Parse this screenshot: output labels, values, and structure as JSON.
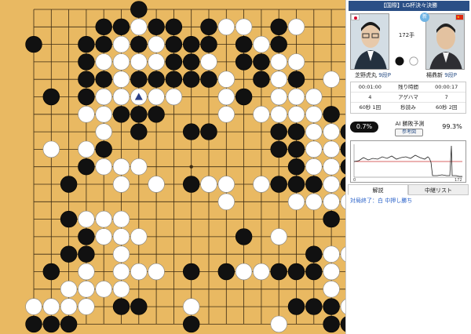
{
  "header": {
    "title": "【国際】LG杯決々決勝"
  },
  "players": {
    "black": {
      "name": "芝野虎丸",
      "rank": "9段P",
      "flag": "japan-flag-icon"
    },
    "white": {
      "name": "楊鼎新",
      "rank": "9段P",
      "flag": "china-flag-icon"
    }
  },
  "move_count": "172手",
  "info": {
    "time_left": {
      "black": "00:01:00",
      "label": "残り時間",
      "white": "00:00:17"
    },
    "captures": {
      "black": "4",
      "label": "アゲハマ",
      "white": "7"
    },
    "byoyomi": {
      "black": "60秒 1回",
      "label": "秒読み",
      "white": "60秒 2回"
    }
  },
  "ai": {
    "label": "AI 勝敗予測",
    "ref_button": "参考図",
    "black_pct": "0.7%",
    "white_pct": "99.3%"
  },
  "graph": {
    "x_start": "0",
    "x_end": "172"
  },
  "tabs": [
    {
      "label": "解説"
    },
    {
      "label": "中継リスト"
    }
  ],
  "comment": "対局終了：白 中押し勝ち",
  "board": {
    "size": 19,
    "last_move_marker": "triangle-marker",
    "rows": [
      "......B............",
      "....BBWBB.BWW.BW...",
      "B..BBWBWBBB.BWB....",
      "...BWWWWBBW.BBWW...",
      "...BBWBBBBBW.BWB.W.",
      ".B.BWWWWW..WB.WWW..",
      "...WWBBB...W.WWWWB.",
      "....W.B..BB...BBWWB",
      ".W.WB.........BBWWB",
      "...BWWW........BWWB",
      "..B..W.W.BWW.WBBBWB",
      "...........W...WWWW",
      "..BWWW...........B.",
      "...BWWW.....B.W....",
      "..BB.W..........BWWW",
      ".B.W.WWW.B.BWWBBBW.",
      "..WWWW...........W.",
      "WWWW.BB..W.....BBBW",
      "BBB......B....W..BB"
    ]
  }
}
